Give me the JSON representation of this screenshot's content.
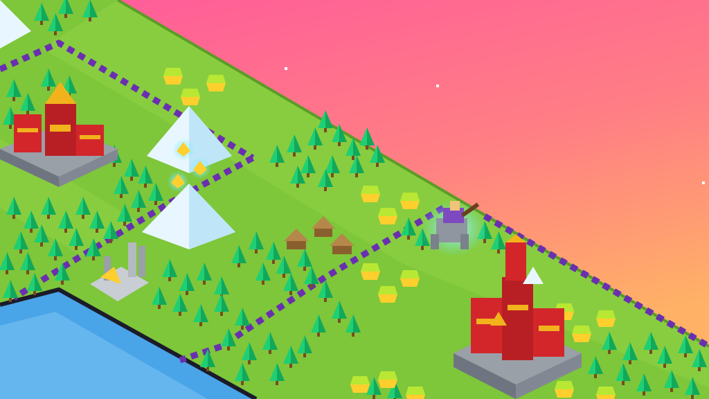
{
  "scene": {
    "sky_gradient": [
      "#ff5a9b",
      "#ff7f84",
      "#ffb266"
    ],
    "grass_color": "#7ec63a",
    "grass_light": "#8fd444",
    "grass_dark": "#6aaf2c",
    "water_color": "#4aa4e8",
    "water_light": "#7cc4f4",
    "border_color": "#6a2fb0",
    "tree_color": "#1fcf74",
    "tree_dark": "#12a85a",
    "fruit_colors": [
      "#b8e833",
      "#ffcf2e"
    ],
    "temple_red": "#d3262b",
    "temple_gold": "#f2b21c",
    "stone_gray": "#9aa0a8",
    "mountain_color": "#e8f7ff",
    "hut_color": "#b5874a"
  },
  "map": {
    "cities": [
      {
        "name": "city-northwest",
        "icon": "temple-city-icon"
      },
      {
        "name": "city-southeast",
        "icon": "temple-city-icon"
      }
    ],
    "units": [
      {
        "name": "elephant-rider-unit",
        "icon": "elephant-icon",
        "selected": true
      }
    ],
    "ruins": [
      {
        "name": "ancient-ruins",
        "icon": "ruins-icon"
      }
    ],
    "villages": [
      {
        "name": "hut-village",
        "icon": "hut-icon"
      }
    ],
    "resources": {
      "fruit_count": 17,
      "gold_count": 3
    }
  }
}
